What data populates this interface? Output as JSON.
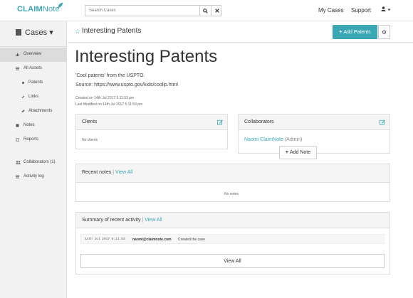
{
  "brand": {
    "claim": "CLAIM",
    "note": "Note"
  },
  "search": {
    "placeholder": "Search Cases"
  },
  "nav": {
    "my_cases": "My Cases",
    "support": "Support"
  },
  "sidebar": {
    "title": "Cases",
    "items": [
      {
        "label": "Overview"
      },
      {
        "label": "All Assets"
      },
      {
        "label": "Patents"
      },
      {
        "label": "Links"
      },
      {
        "label": "Attachments"
      },
      {
        "label": "Notes"
      },
      {
        "label": "Reports"
      },
      {
        "label": "Collaborators (1)"
      },
      {
        "label": "Activity log"
      }
    ]
  },
  "page": {
    "header_title": "Interesting Patents",
    "add_button": "Add Patents",
    "title": "Interesting Patents",
    "description": "'Cool patents' from the USPTO.",
    "source": "Source: https://www.uspto.gov/kids/coolip.html",
    "created": "Created on 14th Jul 2017 5:11:53 pm",
    "modified": "Last Modified on 14th Jul 2017 5:11:53 pm"
  },
  "clients": {
    "title": "Clients",
    "empty": "No clients"
  },
  "collaborators": {
    "title": "Collaborators",
    "name": "Naomi ClaimNote",
    "role": "(Admin)"
  },
  "notes": {
    "title": "Recent notes",
    "sep": "|",
    "view_all": "View All",
    "add_button": "Add Note",
    "empty": "No notes"
  },
  "activity": {
    "title": "Summary of recent activity",
    "sep": "|",
    "view_all": "View All",
    "rows": [
      {
        "timestamp": "14th Jul 2017 5:11:53",
        "user": "naomi@claimnote.com",
        "action": "Created the case"
      }
    ],
    "view_all_button": "View All"
  },
  "colors": {
    "accent": "#3aa7b5"
  }
}
